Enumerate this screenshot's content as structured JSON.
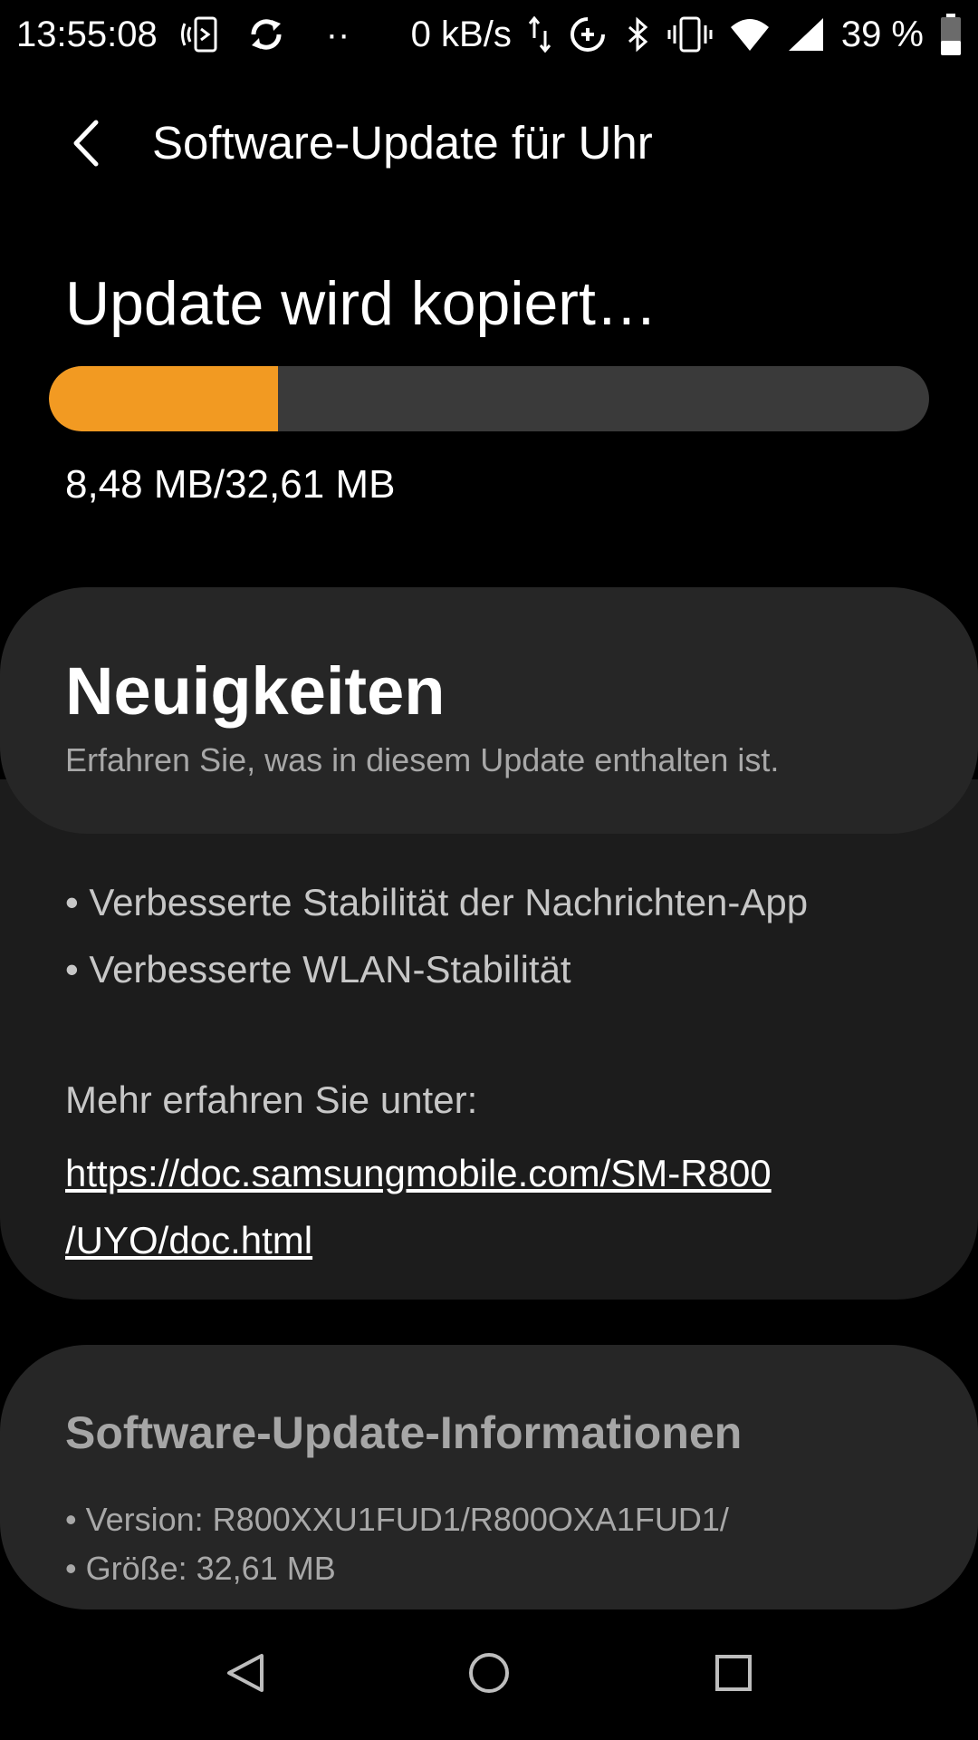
{
  "status_bar": {
    "time": "13:55:08",
    "dots": "··",
    "network_speed": "0 kB/s",
    "battery_percent": "39 %",
    "battery_level": 0.39,
    "icons": [
      "nfc-phone-icon",
      "sync-icon",
      "data-transfer-icon",
      "data-saver-icon",
      "bluetooth-icon",
      "vibrate-icon",
      "wifi-icon",
      "signal-icon",
      "battery-icon"
    ]
  },
  "app_bar": {
    "back_icon": "chevron-left-icon",
    "title": "Software-Update für Uhr"
  },
  "progress": {
    "status": "Update wird kopiert…",
    "downloaded_mb": 8.48,
    "total_mb": 32.61,
    "text": "8,48 MB/32,61 MB",
    "fill_color": "#f29a22",
    "track_color": "#3a3a3a"
  },
  "news": {
    "title": "Neuigkeiten",
    "subtitle": "Erfahren Sie, was in diesem Update enthalten ist.",
    "items": [
      "• Verbesserte Stabilität der Nachrichten-App",
      "• Verbesserte WLAN-Stabilität"
    ],
    "more_label": "Mehr erfahren Sie unter:",
    "link": "https://doc.samsungmobile.com/SM-R800/UYO/doc.html",
    "link_line1": "https://doc.samsungmobile.com/SM-R800",
    "link_line2": "/UYO/doc.html"
  },
  "info": {
    "title": "Software-Update-Informationen",
    "version": "• Version: R800XXU1FUD1/R800OXA1FUD1/",
    "size": "• Größe: 32,61 MB"
  },
  "nav_bar": {
    "icons": [
      "back-triangle-icon",
      "home-circle-icon",
      "recents-square-icon"
    ]
  }
}
